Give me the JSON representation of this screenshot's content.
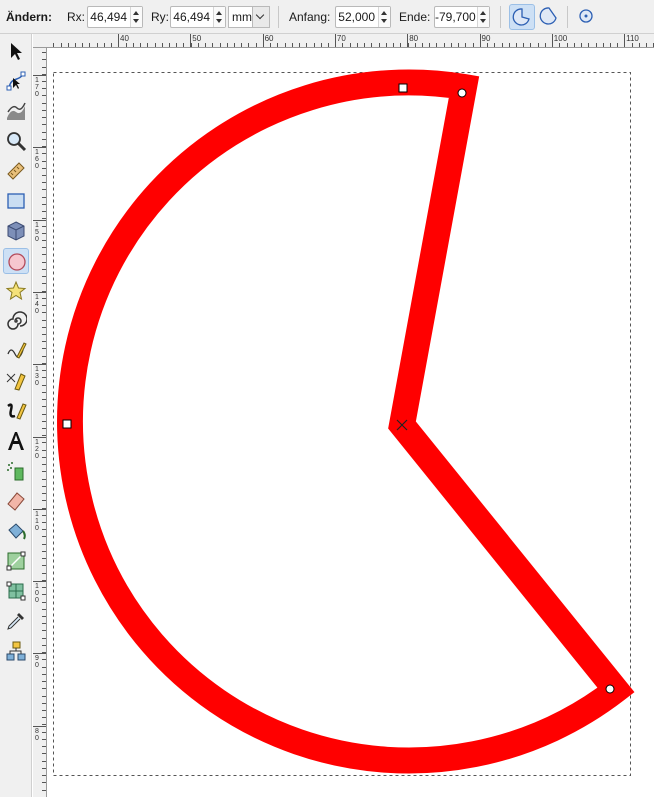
{
  "toolbar": {
    "change_label": "Ändern:",
    "rx_label": "Rx:",
    "rx_value": "46,494",
    "ry_label": "Ry:",
    "ry_value": "46,494",
    "unit": "mm",
    "start_label": "Anfang:",
    "start_value": "52,000",
    "end_label": "Ende:",
    "end_value": "-79,700",
    "arc_type_buttons": [
      "slice-icon",
      "arc-icon",
      "whole-ellipse-icon"
    ],
    "active_arc_type": "slice-icon"
  },
  "tools": [
    {
      "name": "selector-tool-icon"
    },
    {
      "name": "node-tool-icon"
    },
    {
      "name": "tweak-tool-icon"
    },
    {
      "name": "zoom-tool-icon"
    },
    {
      "name": "measure-tool-icon"
    },
    {
      "name": "rectangle-tool-icon"
    },
    {
      "name": "3d-box-tool-icon"
    },
    {
      "name": "ellipse-tool-icon",
      "active": true
    },
    {
      "name": "star-tool-icon"
    },
    {
      "name": "spiral-tool-icon"
    },
    {
      "name": "pencil-tool-icon"
    },
    {
      "name": "pen-tool-icon"
    },
    {
      "name": "calligraphy-tool-icon"
    },
    {
      "name": "text-tool-icon"
    },
    {
      "name": "spray-tool-icon"
    },
    {
      "name": "eraser-tool-icon"
    },
    {
      "name": "paint-bucket-tool-icon"
    },
    {
      "name": "gradient-tool-icon"
    },
    {
      "name": "mesh-tool-icon"
    },
    {
      "name": "dropper-tool-icon"
    },
    {
      "name": "connector-tool-icon"
    }
  ],
  "ruler": {
    "h_labels": [
      "40",
      "50",
      "60",
      "70",
      "80",
      "90",
      "100",
      "110"
    ],
    "v_labels": [
      "170",
      "160",
      "150",
      "140",
      "130",
      "120",
      "110",
      "100",
      "90",
      "80"
    ]
  },
  "shape": {
    "stroke_color": "#ff0000",
    "fill": "none"
  },
  "colors": {
    "accent": "#cde0f5",
    "chrome": "#f0f0f0"
  }
}
